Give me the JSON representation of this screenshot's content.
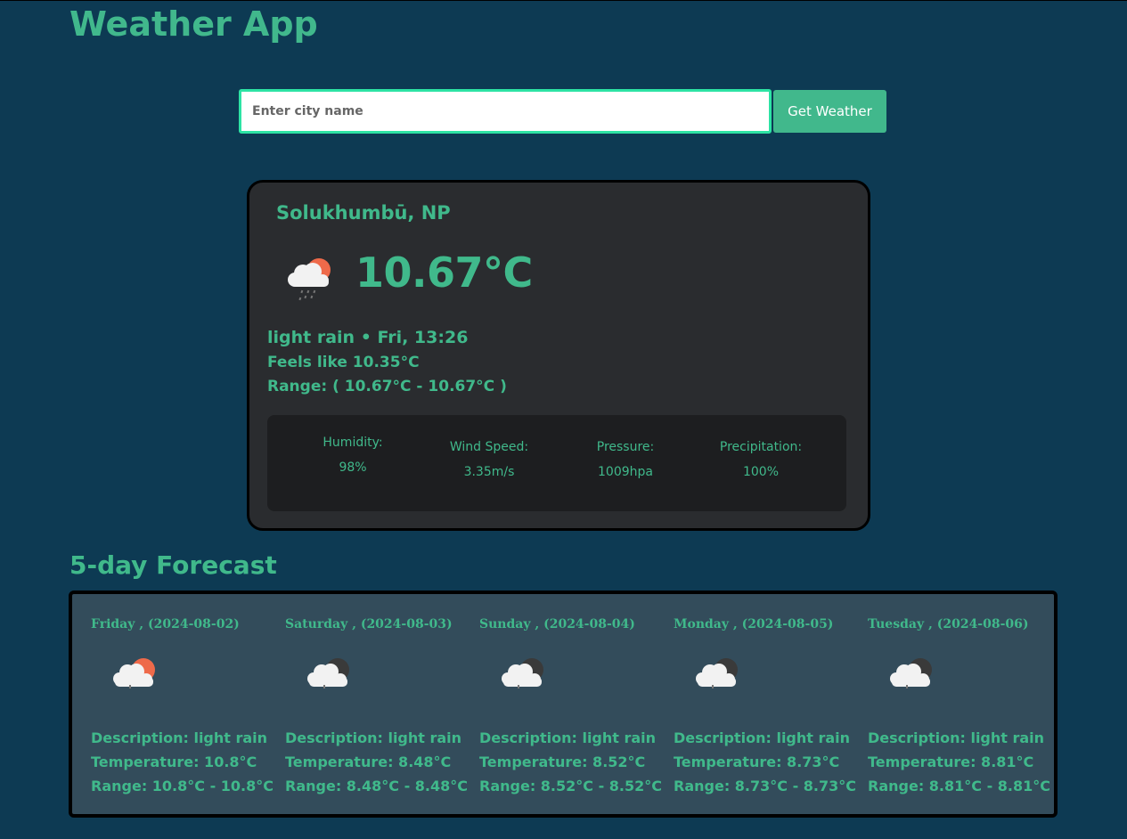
{
  "app": {
    "title": "Weather App"
  },
  "search": {
    "placeholder": "Enter city name",
    "value": "",
    "button_label": "Get Weather"
  },
  "current": {
    "location": "Solukhumbū, NP",
    "icon": "rain-cloud-sun-icon",
    "temperature": "10.67°C",
    "description_line": "light rain • Fri, 13:26",
    "feels_like": "Feels like 10.35°C",
    "range": "Range: ( 10.67°C - 10.67°C )",
    "stats": [
      {
        "label": "Humidity:",
        "value": "98%"
      },
      {
        "label": "Wind Speed:",
        "value": "3.35m/s"
      },
      {
        "label": "Pressure:",
        "value": "1009hpa"
      },
      {
        "label": "Precipitation:",
        "value": "100%"
      }
    ]
  },
  "forecast": {
    "title": "5-day Forecast",
    "days": [
      {
        "date": "Friday , (2024-08-02)",
        "icon": "cloud-sun-icon",
        "description": "Description: light rain",
        "temperature": "Temperature: 10.8°C",
        "range": "Range: 10.8°C - 10.8°C"
      },
      {
        "date": "Saturday , (2024-08-03)",
        "icon": "cloud-moon-icon",
        "description": "Description: light rain",
        "temperature": "Temperature: 8.48°C",
        "range": "Range: 8.48°C - 8.48°C"
      },
      {
        "date": "Sunday , (2024-08-04)",
        "icon": "cloud-moon-icon",
        "description": "Description: light rain",
        "temperature": "Temperature: 8.52°C",
        "range": "Range: 8.52°C - 8.52°C"
      },
      {
        "date": "Monday , (2024-08-05)",
        "icon": "cloud-moon-icon",
        "description": "Description: light rain",
        "temperature": "Temperature: 8.73°C",
        "range": "Range: 8.73°C - 8.73°C"
      },
      {
        "date": "Tuesday , (2024-08-06)",
        "icon": "cloud-moon-icon",
        "description": "Description: light rain",
        "temperature": "Temperature: 8.81°C",
        "range": "Range: 8.81°C - 8.81°C"
      }
    ]
  },
  "colors": {
    "background": "#0d3a53",
    "accent": "#41b88c",
    "input_border": "#2de3a4",
    "card": "#2a2c2f",
    "stats_panel": "#1d1e20",
    "forecast_panel": "#334c5b"
  }
}
